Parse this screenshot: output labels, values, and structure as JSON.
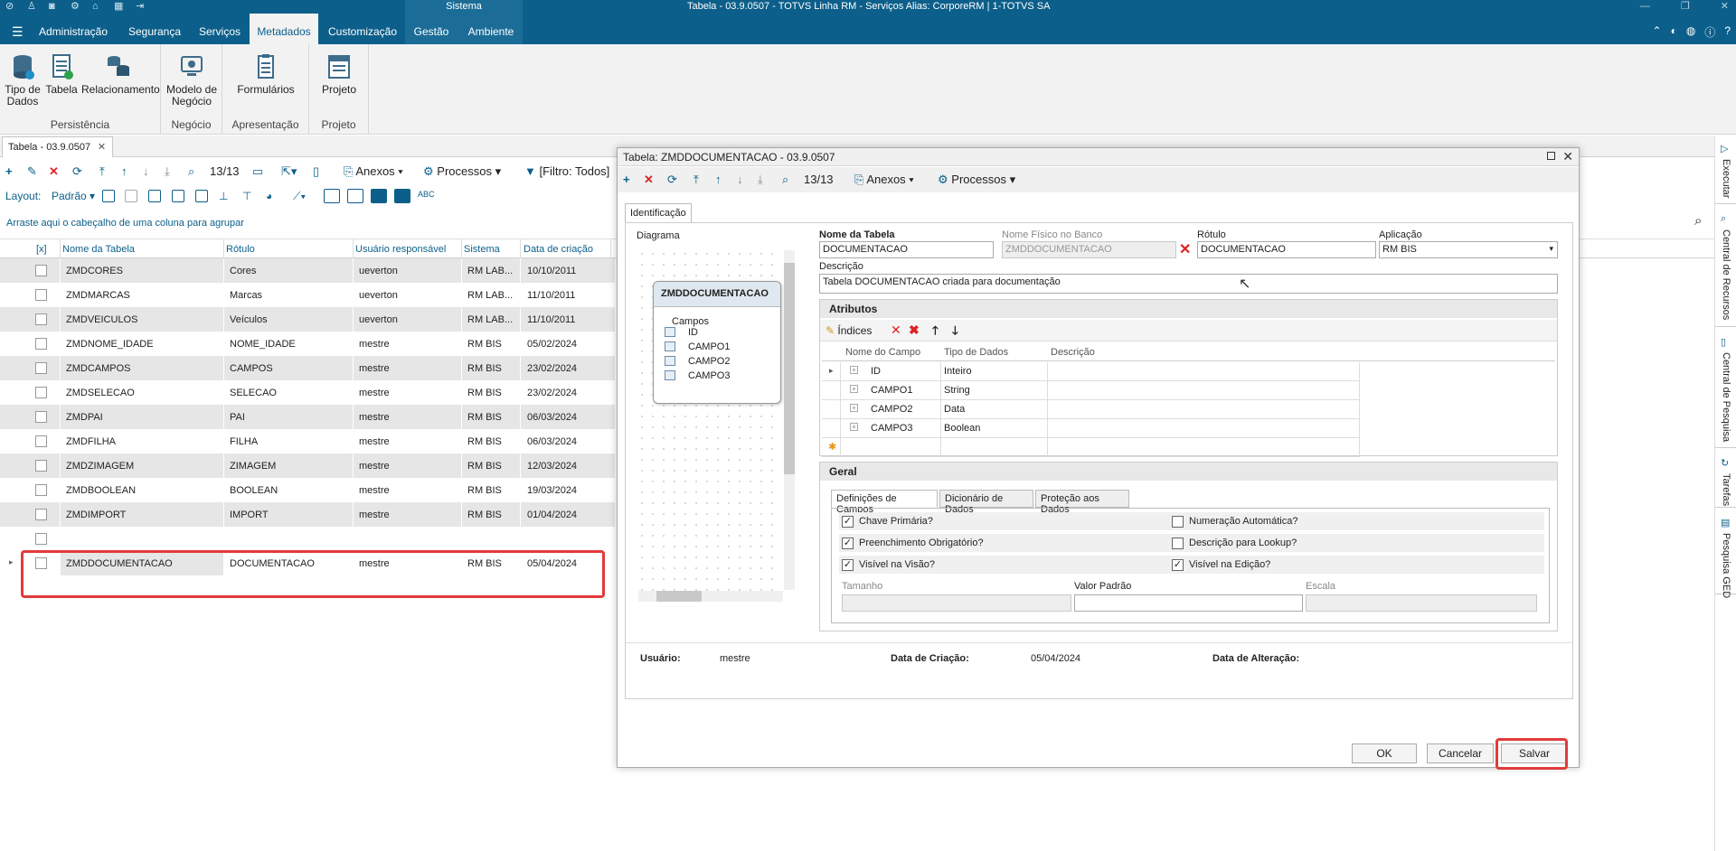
{
  "titlebar": {
    "sistema": "Sistema",
    "title": "Tabela - 03.9.0507 - TOTVS Linha RM - Serviços  Alias: CorporeRM | 1-TOTVS SA"
  },
  "tabs": [
    "Administração",
    "Segurança",
    "Serviços",
    "Metadados",
    "Customização",
    "Gestão",
    "Ambiente"
  ],
  "ribbon": {
    "persistencia": {
      "label": "Persistência",
      "buttons": [
        "Tipo de Dados",
        "Tabela",
        "Relacionamento"
      ]
    },
    "negocio": {
      "label": "Negócio",
      "buttons": [
        "Modelo de Negócio"
      ]
    },
    "apresentacao": {
      "label": "Apresentação",
      "buttons": [
        "Formulários"
      ]
    },
    "projeto": {
      "label": "Projeto",
      "buttons": [
        "Projeto"
      ]
    }
  },
  "doc_tab": {
    "label": "Tabela - 03.9.0507"
  },
  "main_toolbar": {
    "counter": "13/13",
    "anexos": "Anexos",
    "processos": "Processos",
    "filtro": "[Filtro: Todos]",
    "layout_label": "Layout:",
    "layout_value": "Padrão"
  },
  "group_hint": "Arraste aqui o cabeçalho de uma coluna para agrupar",
  "grid": {
    "columns": [
      "[x]",
      "Nome da Tabela",
      "Rótulo",
      "Usuário responsável",
      "Sistema",
      "Data de criação"
    ],
    "rows": [
      [
        "ZMDCORES",
        "Cores",
        "ueverton",
        "RM LAB...",
        "10/10/2011"
      ],
      [
        "ZMDMARCAS",
        "Marcas",
        "ueverton",
        "RM LAB...",
        "11/10/2011"
      ],
      [
        "ZMDVEICULOS",
        "Veículos",
        "ueverton",
        "RM LAB...",
        "11/10/2011"
      ],
      [
        "ZMDNOME_IDADE",
        "NOME_IDADE",
        "mestre",
        "RM BIS",
        "05/02/2024"
      ],
      [
        "ZMDCAMPOS",
        "CAMPOS",
        "mestre",
        "RM BIS",
        "23/02/2024"
      ],
      [
        "ZMDSELECAO",
        "SELECAO",
        "mestre",
        "RM BIS",
        "23/02/2024"
      ],
      [
        "ZMDPAI",
        "PAI",
        "mestre",
        "RM BIS",
        "06/03/2024"
      ],
      [
        "ZMDFILHA",
        "FILHA",
        "mestre",
        "RM BIS",
        "06/03/2024"
      ],
      [
        "ZMDZIMAGEM",
        "ZIMAGEM",
        "mestre",
        "RM BIS",
        "12/03/2024"
      ],
      [
        "ZMDBOOLEAN",
        "BOOLEAN",
        "mestre",
        "RM BIS",
        "19/03/2024"
      ],
      [
        "ZMDIMPORT",
        "IMPORT",
        "mestre",
        "RM BIS",
        "01/04/2024"
      ],
      [
        "",
        "",
        "",
        "",
        ""
      ],
      [
        "ZMDDOCUMENTACAO",
        "DOCUMENTACAO",
        "mestre",
        "RM BIS",
        "05/04/2024"
      ]
    ]
  },
  "side_tabs": [
    "Executar",
    "Central de Recursos",
    "Central de Pesquisa",
    "Tarefas",
    "Pesquisa GED"
  ],
  "dialog": {
    "title": "Tabela: ZMDDOCUMENTACAO - 03.9.0507",
    "counter": "13/13",
    "anexos": "Anexos",
    "processos": "Processos",
    "tab_identificacao": "Identificação",
    "diagrama_label": "Diagrama",
    "diagram_box": {
      "title": "ZMDDOCUMENTACAO",
      "section": "Campos",
      "fields": [
        "ID",
        "CAMPO1",
        "CAMPO2",
        "CAMPO3"
      ]
    },
    "nome_tabela_label": "Nome da Tabela",
    "nome_tabela": "DOCUMENTACAO",
    "nome_fisico_label": "Nome Físico no Banco",
    "nome_fisico": "ZMDDOCUMENTACAO",
    "rotulo_label": "Rótulo",
    "rotulo": "DOCUMENTACAO",
    "aplicacao_label": "Aplicação",
    "aplicacao": "RM BIS",
    "descricao_label": "Descrição",
    "descricao": "Tabela DOCUMENTACAO criada para documentação",
    "atributos_label": "Atributos",
    "indices_label": "Índices",
    "attr_columns": [
      "Nome do Campo",
      "Tipo de Dados",
      "Descrição"
    ],
    "attr_rows": [
      [
        "ID",
        "Inteiro",
        ""
      ],
      [
        "CAMPO1",
        "String",
        ""
      ],
      [
        "CAMPO2",
        "Data",
        ""
      ],
      [
        "CAMPO3",
        "Boolean",
        ""
      ]
    ],
    "geral_label": "Geral",
    "subtabs": [
      "Definições de Campos",
      "Dicionário de Dados",
      "Proteção aos Dados"
    ],
    "checks": {
      "chave_primaria": {
        "label": "Chave Primária?",
        "checked": true
      },
      "numeracao_auto": {
        "label": "Numeração Automática?",
        "checked": false
      },
      "preenchimento": {
        "label": "Preenchimento Obrigatório?",
        "checked": true
      },
      "descricao_lookup": {
        "label": "Descrição para Lookup?",
        "checked": false
      },
      "visivel_visao": {
        "label": "Visível na Visão?",
        "checked": true
      },
      "visivel_edicao": {
        "label": "Visível na Edição?",
        "checked": true
      }
    },
    "tamanho_label": "Tamanho",
    "valor_padrao_label": "Valor Padrão",
    "escala_label": "Escala",
    "usuario_label": "Usuário:",
    "usuario": "mestre",
    "data_criacao_label": "Data de Criação:",
    "data_criacao": "05/04/2024",
    "data_alteracao_label": "Data de Alteração:",
    "ok": "OK",
    "cancelar": "Cancelar",
    "salvar": "Salvar"
  },
  "colors": {
    "brand": "#0c5f8a",
    "highlight": "#e23b3b",
    "row_alt": "#e6e6e6"
  }
}
